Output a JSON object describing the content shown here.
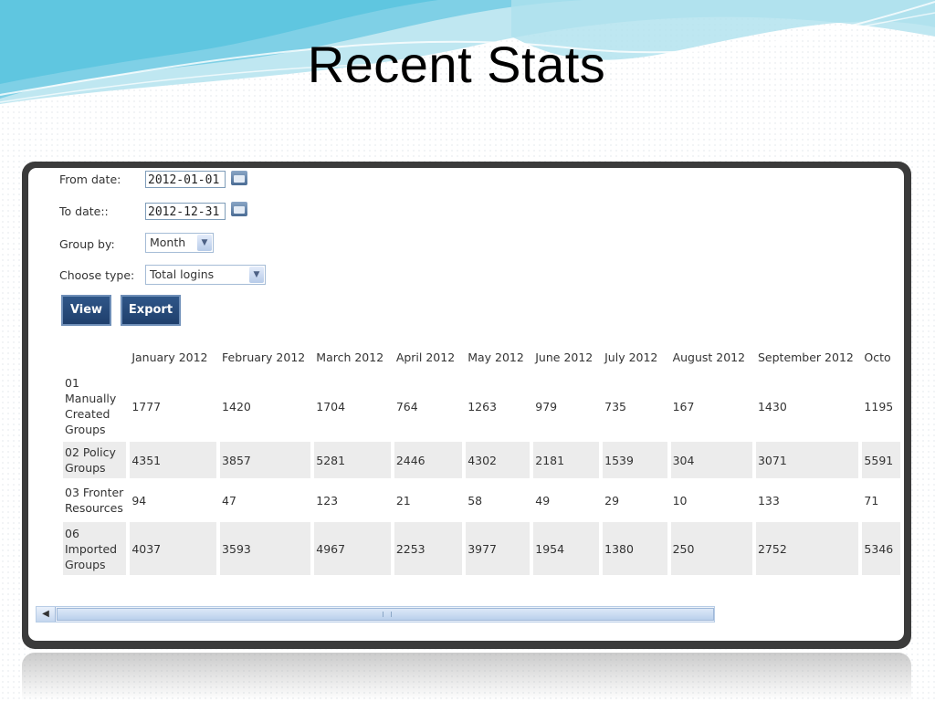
{
  "slide": {
    "title": "Recent Stats"
  },
  "form": {
    "from_label": "From date:",
    "from_value": "2012-01-01",
    "to_label": "To date::",
    "to_value": "2012-12-31",
    "group_label": "Group by:",
    "group_value": "Month",
    "type_label": "Choose type:",
    "type_value": "Total logins",
    "view_label": "View",
    "export_label": "Export"
  },
  "icons": {
    "calendar": "calendar-icon",
    "dropdown": "chevron-down-icon",
    "scroll_left": "arrow-left-icon"
  },
  "table": {
    "columns": [
      "January 2012",
      "February 2012",
      "March 2012",
      "April 2012",
      "May 2012",
      "June 2012",
      "July 2012",
      "August 2012",
      "September 2012",
      "Octo"
    ],
    "rows": [
      {
        "label": "01 Manually Created Groups",
        "values": [
          "1777",
          "1420",
          "1704",
          "764",
          "1263",
          "979",
          "735",
          "167",
          "1430",
          "1195"
        ]
      },
      {
        "label": "02 Policy Groups",
        "values": [
          "4351",
          "3857",
          "5281",
          "2446",
          "4302",
          "2181",
          "1539",
          "304",
          "3071",
          "5591"
        ]
      },
      {
        "label": "03 Fronter Resources",
        "values": [
          "94",
          "47",
          "123",
          "21",
          "58",
          "49",
          "29",
          "10",
          "133",
          "71"
        ]
      },
      {
        "label": "06 Imported Groups",
        "values": [
          "4037",
          "3593",
          "4967",
          "2253",
          "3977",
          "1954",
          "1380",
          "250",
          "2752",
          "5346"
        ]
      }
    ]
  },
  "colors": {
    "button_bg": "#1f3f6c",
    "row_alt": "#ececec",
    "frame": "#3b3b3b",
    "wave": "#5fc6e0"
  }
}
